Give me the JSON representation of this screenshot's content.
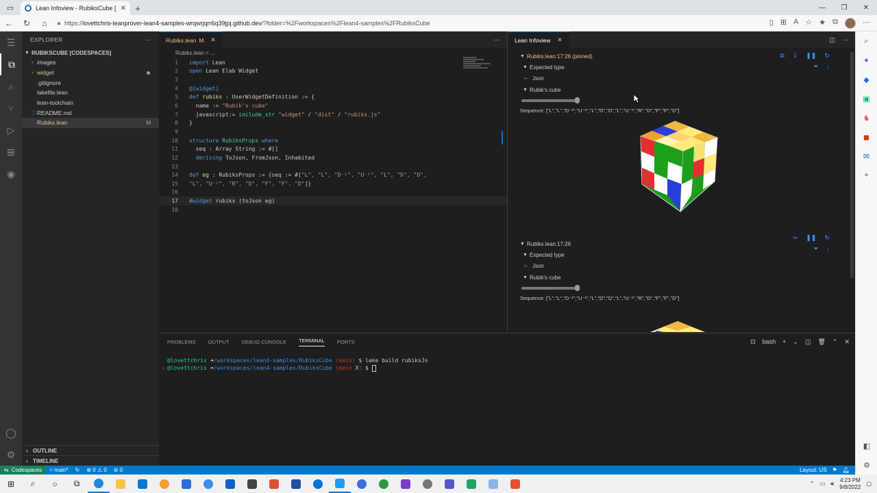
{
  "browser": {
    "tab_title": "Lean Infoview - RubiksCube [Co",
    "url_prefix": "https://",
    "url_host": "lovettchris-leanprover-lean4-samples-wrqwrjqrr6q39jpj.github.dev",
    "url_path": "/?folder=%2Fworkspaces%2Flean4-samples%2FRubiksCube"
  },
  "sidebar": {
    "header": "EXPLORER",
    "root": "RUBIKSCUBE [CODESPACES]",
    "items": [
      {
        "label": "images",
        "type": "folder"
      },
      {
        "label": "widget",
        "type": "folder"
      },
      {
        "label": ".gitignore",
        "type": "file"
      },
      {
        "label": "lakefile.lean",
        "type": "file"
      },
      {
        "label": "lean-toolchain",
        "type": "file"
      },
      {
        "label": "README.md",
        "type": "file"
      },
      {
        "label": "Rubiks.lean",
        "type": "file",
        "badge": "M"
      }
    ],
    "outline": "OUTLINE",
    "timeline": "TIMELINE"
  },
  "editor": {
    "tab_label": "Rubiks.lean",
    "tab_badge": "M",
    "breadcrumb": "Rubiks.lean > ...",
    "lines": [
      "1",
      "2",
      "3",
      "4",
      "5",
      "6",
      "7",
      "8",
      "9",
      "10",
      "11",
      "12",
      "13",
      "14",
      "15",
      "16",
      "17",
      "18"
    ],
    "code": {
      "l1a": "import",
      "l1b": " Lean",
      "l2a": "open",
      "l2b": " Lean Elab Widget",
      "l4": "@[widget]",
      "l5a": "def",
      "l5b": " rubiks",
      "l5c": " : UserWidgetDefinition := {",
      "l6a": "  name := ",
      "l6b": "\"Rubik's cube\"",
      "l7a": "  javascript:= ",
      "l7b": "include_str",
      "l7c": " \"widget\"",
      "l7d": " / ",
      "l7e": "\"dist\"",
      "l7f": " / ",
      "l7g": "\"rubiks.js\"",
      "l8": "}",
      "l10a": "structure",
      "l10b": " RubiksProps ",
      "l10c": "where",
      "l11a": "  seq : Array String := #[]",
      "l12a": "  deriving",
      "l12b": " ToJson, FromJson, Inhabited",
      "l14a": "def",
      "l14b": " eg",
      "l14c": " : RubiksProps := {seq := #[",
      "l14d": "\"L\", \"L\", \"D⁻¹\", \"U⁻¹\", \"L\", \"D\", \"D\",",
      "l15": "\"L\", \"U⁻¹\", \"R\", \"D\", \"F\", \"F\", \"D\"",
      "l15b": "]}",
      "l17a": "#widget",
      "l17b": " rubiks (toJson eg)"
    }
  },
  "infoview": {
    "tab_label": "Lean Infoview",
    "block1": {
      "header": "Rubiks.lean:17:26 (pinned)",
      "expected_type": "Expected type",
      "type_value": "Json",
      "widget_label": "Rubik's cube",
      "sequence": "Sequence: [\"L\",\"L\",\"D⁻¹\",\"U⁻¹\",\"L\",\"D\",\"D\",\"L\",\"U⁻¹\",\"R\",\"D\",\"F\",\"F\",\"D\"]"
    },
    "block2": {
      "header": "Rubiks.lean:17:26",
      "expected_type": "Expected type",
      "type_value": "Json",
      "widget_label": "Rubik's cube",
      "sequence": "Sequence: [\"L\",\"L\",\"D⁻¹\",\"U⁻¹\",\"L\",\"D\",\"D\",\"L\",\"U⁻¹\",\"R\",\"D\",\"F\",\"F\",\"D\"]"
    }
  },
  "panel": {
    "tabs": [
      "PROBLEMS",
      "OUTPUT",
      "DEBUG CONSOLE",
      "TERMINAL",
      "PORTS"
    ],
    "active_tab": "TERMINAL",
    "shell": "bash",
    "line1": {
      "user": "@lovettchris",
      "arrow": " ➜",
      "path": "/workspaces/lean4-samples/RubiksCube",
      "branch_open": " (",
      "branch": "main",
      "branch_close": ")",
      "cmd": " $ lake build rubiksJs"
    },
    "line2": {
      "user": "@lovettchris",
      "arrow": " ➜",
      "path": "/workspaces/lean4-samples/RubiksCube",
      "branch_open": " (",
      "branch": "main",
      "dirty": " X",
      "branch_close": ")",
      "cmd": " $ "
    }
  },
  "statusbar": {
    "remote": "Codespaces",
    "branch": "main*",
    "errors": "⊗ 0 ⚠ 0",
    "ports": "⊘ 0",
    "layout": "Layout: US"
  },
  "taskbar": {
    "time": "4:23 PM",
    "date": "9/8/2022"
  },
  "colors": {
    "accent": "#007acc",
    "remote": "#16825d",
    "modified": "#e2c08d"
  }
}
